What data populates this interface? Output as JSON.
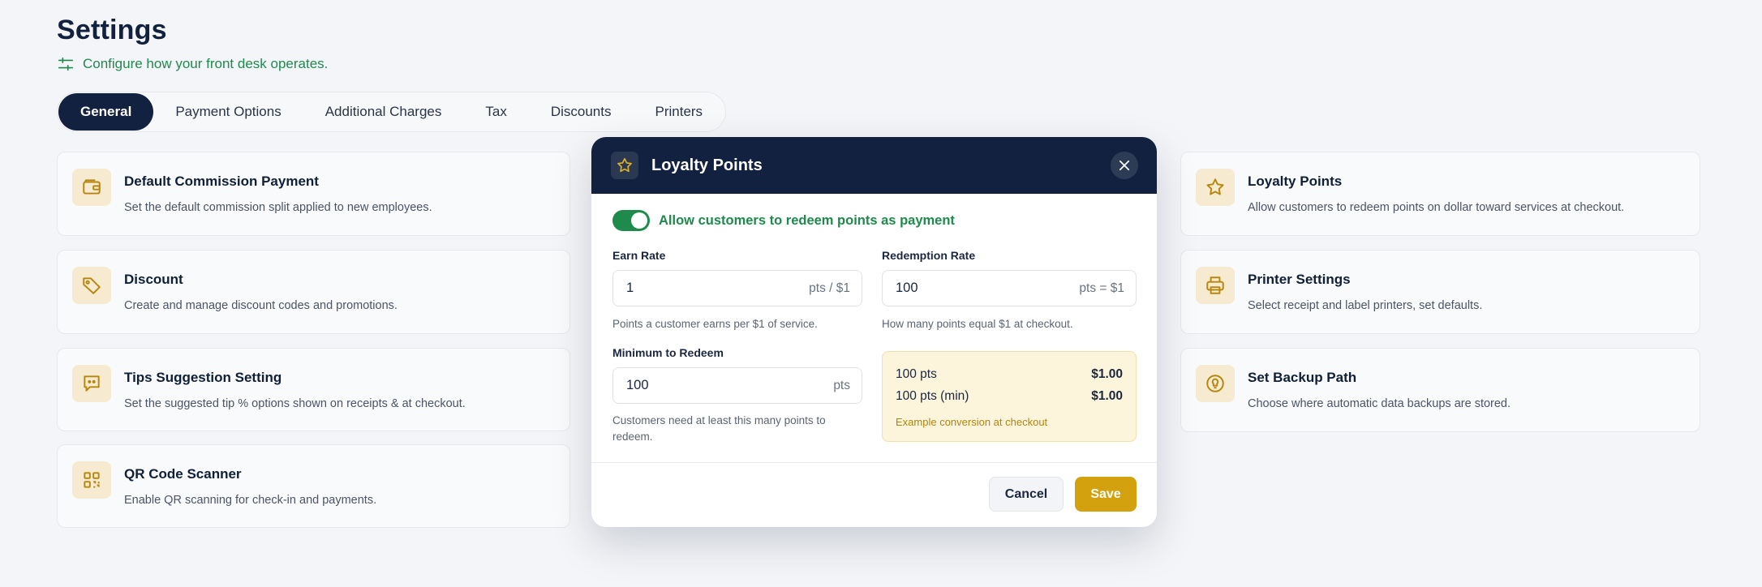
{
  "header": {
    "title": "Settings",
    "subtitle": "Configure how your front desk operates.",
    "subtitle_icon": "sliders-icon"
  },
  "tabs": [
    {
      "label": "General",
      "active": true
    },
    {
      "label": "Payment Options",
      "active": false
    },
    {
      "label": "Additional Charges",
      "active": false
    },
    {
      "label": "Tax",
      "active": false
    },
    {
      "label": "Discounts",
      "active": false
    },
    {
      "label": "Printers",
      "active": false
    }
  ],
  "left_cards": [
    {
      "title": "Default Commission Payment",
      "description": "Set the default commission split applied to new employees.",
      "icon": "wallet-icon"
    },
    {
      "title": "Discount",
      "description": "Create and manage discount codes and promotions.",
      "icon": "tag-icon"
    },
    {
      "title": "Tips Suggestion Setting",
      "description": "Set the suggested tip % options shown on receipts & at checkout.",
      "icon": "message-icon"
    },
    {
      "title": "QR Code Scanner",
      "description": "Enable QR scanning for check-in and payments.",
      "icon": "qr-code-icon"
    }
  ],
  "right_cards": [
    {
      "title": "Loyalty Points",
      "description": "Allow customers to redeem points on dollar toward services at checkout.",
      "icon": "star-icon"
    },
    {
      "title": "Printer Settings",
      "description": "Select receipt and label printers, set defaults.",
      "icon": "printer-icon"
    },
    {
      "title": "Set Backup Path",
      "description": "Choose where automatic data backups are stored.",
      "icon": "lightbulb-icon"
    }
  ],
  "modal": {
    "title": "Loyalty Points",
    "toggle_label": "Allow customers to redeem points as payment",
    "toggle_on": true,
    "earn_rate": {
      "label": "Earn Rate",
      "value": "1",
      "unit": "pts / $1",
      "help": "Points a customer earns per $1 of service."
    },
    "redemption_rate": {
      "label": "Redemption Rate",
      "value": "100",
      "unit": "pts = $1",
      "help": "How many points equal $1 at checkout."
    },
    "minimum": {
      "label": "Minimum to Redeem",
      "value": "100",
      "unit": "pts",
      "help": "Customers need at least this many points to redeem."
    },
    "example": {
      "rows": [
        {
          "left": "100 pts",
          "right": "$1.00"
        },
        {
          "left": "100 pts (min)",
          "right": "$1.00"
        }
      ],
      "caption": "Example conversion at checkout"
    },
    "cancel_label": "Cancel",
    "save_label": "Save"
  },
  "colors": {
    "navy": "#12213f",
    "accent_gold": "#d4a10e",
    "green": "#1e8a4c",
    "icon_bg": "#f6ead1"
  }
}
